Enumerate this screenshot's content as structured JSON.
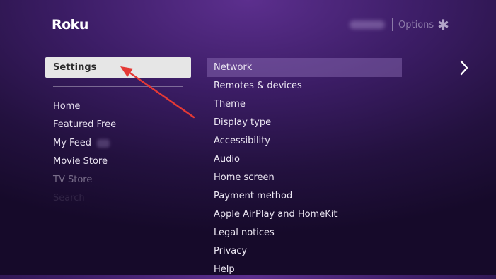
{
  "brand": {
    "logo_text": "Roku"
  },
  "topbar": {
    "options_label": "Options",
    "options_icon": "asterisk-icon"
  },
  "left_menu": {
    "selected": "Settings",
    "items": [
      {
        "label": "Home"
      },
      {
        "label": "Featured Free"
      },
      {
        "label": "My Feed"
      },
      {
        "label": "Movie Store"
      },
      {
        "label": "TV Store"
      },
      {
        "label": "Search"
      }
    ]
  },
  "right_menu": {
    "items": [
      {
        "label": "Network"
      },
      {
        "label": "Remotes & devices"
      },
      {
        "label": "Theme"
      },
      {
        "label": "Display type"
      },
      {
        "label": "Accessibility"
      },
      {
        "label": "Audio"
      },
      {
        "label": "Home screen"
      },
      {
        "label": "Payment method"
      },
      {
        "label": "Apple AirPlay and HomeKit"
      },
      {
        "label": "Legal notices"
      },
      {
        "label": "Privacy"
      },
      {
        "label": "Help"
      }
    ]
  },
  "colors": {
    "selected_bg": "#e6e6e6",
    "highlight_bg": "#8f73b6",
    "annotation_arrow": "#e53935"
  }
}
